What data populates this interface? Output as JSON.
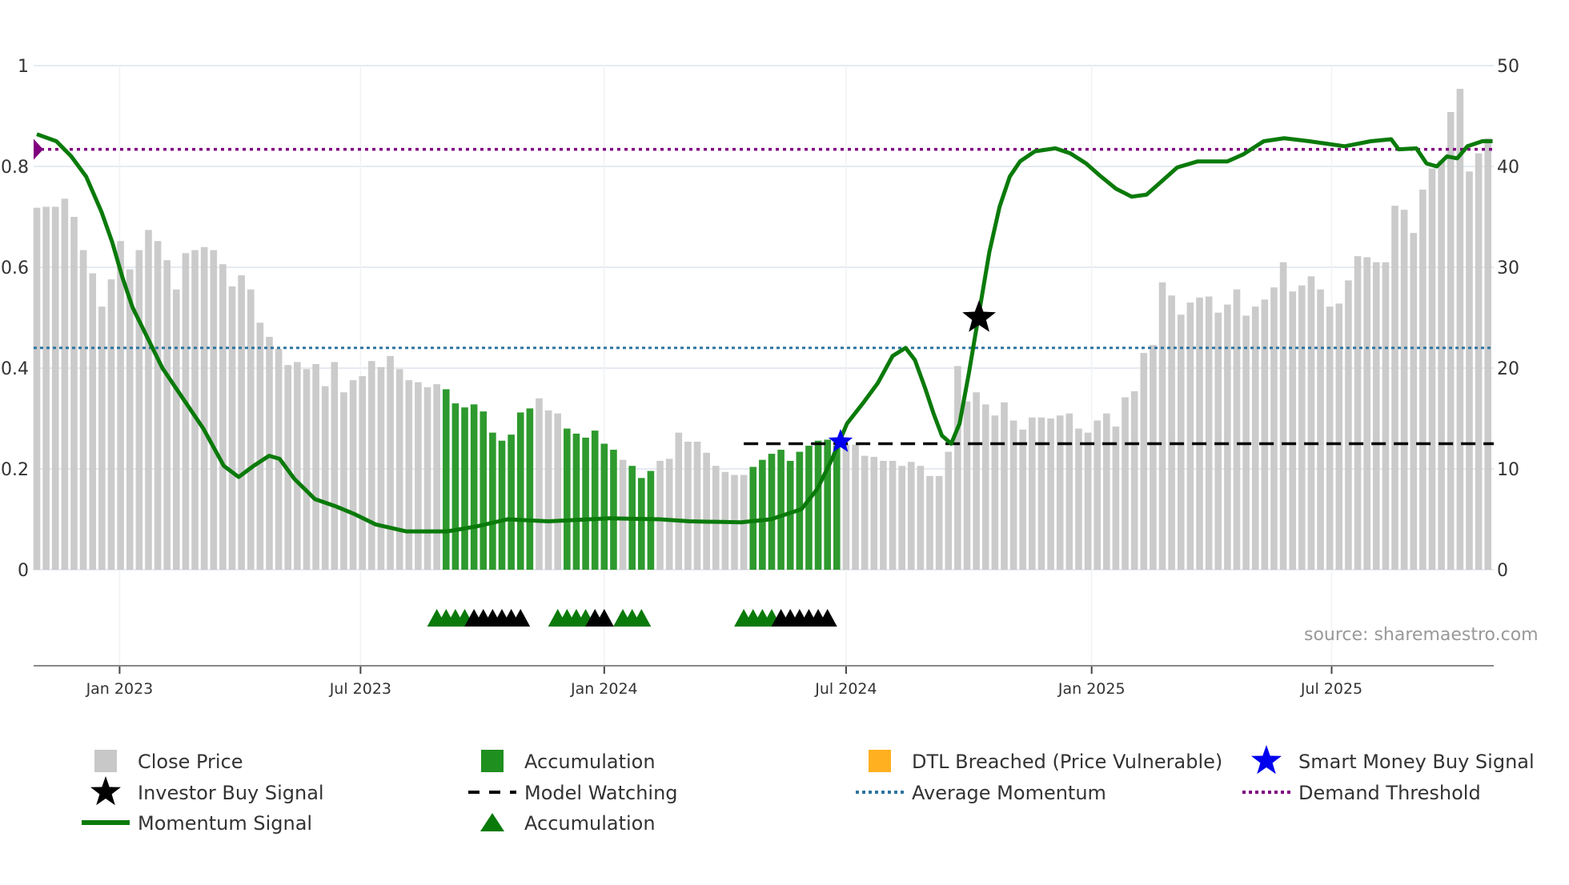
{
  "chart_data": {
    "type": "bar",
    "source": "source: sharemaestro.com",
    "left_axis": {
      "ylim": [
        0,
        1
      ],
      "ticks": [
        "0",
        "0.2",
        "0.4",
        "0.6",
        "0.8",
        "1"
      ],
      "tick_values": [
        0,
        0.2,
        0.4,
        0.6,
        0.8,
        1
      ]
    },
    "right_axis": {
      "ylim": [
        0,
        50
      ],
      "ticks": [
        "0",
        "10",
        "20",
        "30",
        "40",
        "50"
      ],
      "tick_values": [
        0,
        10,
        20,
        30,
        40,
        50
      ]
    },
    "x_ticks": [
      {
        "label": "Jan 2023",
        "week": 8.9
      },
      {
        "label": "Jul 2023",
        "week": 34.8
      },
      {
        "label": "Jan 2024",
        "week": 61.0
      },
      {
        "label": "Jul 2024",
        "week": 87.0
      },
      {
        "label": "Jan 2025",
        "week": 113.4
      },
      {
        "label": "Jul 2025",
        "week": 139.2
      }
    ],
    "grid": true,
    "close_price": [
      35.9,
      36.0,
      36.0,
      36.8,
      35.0,
      31.7,
      29.4,
      26.1,
      28.8,
      32.6,
      29.8,
      31.7,
      33.7,
      32.6,
      30.7,
      27.8,
      31.4,
      31.7,
      32.0,
      31.7,
      30.3,
      28.1,
      29.2,
      27.8,
      24.5,
      23.1,
      21.9,
      20.3,
      20.6,
      19.9,
      20.4,
      18.2,
      20.6,
      17.6,
      18.8,
      19.2,
      20.7,
      20.1,
      21.2,
      19.9,
      18.8,
      18.6,
      18.1,
      18.4,
      17.9,
      16.5,
      16.1,
      16.4,
      15.7,
      13.6,
      12.8,
      13.4,
      15.6,
      16.0,
      17.0,
      15.8,
      15.5,
      14.0,
      13.5,
      13.1,
      13.8,
      12.5,
      11.9,
      10.9,
      10.3,
      9.1,
      9.8,
      10.8,
      11.0,
      13.6,
      12.7,
      12.7,
      11.6,
      10.3,
      9.7,
      9.4,
      9.4,
      10.2,
      10.9,
      11.5,
      11.9,
      10.8,
      11.7,
      12.3,
      12.8,
      12.9,
      12.3,
      12.4,
      12.4,
      11.3,
      11.2,
      10.8,
      10.8,
      10.3,
      10.7,
      10.3,
      9.3,
      9.3,
      11.7,
      20.2,
      16.7,
      17.6,
      16.4,
      15.3,
      16.6,
      14.8,
      13.9,
      15.1,
      15.1,
      15.0,
      15.3,
      15.5,
      14.0,
      13.6,
      14.8,
      15.5,
      14.2,
      17.1,
      17.7,
      21.5,
      22.3,
      28.5,
      27.2,
      25.3,
      26.5,
      27.0,
      27.1,
      25.5,
      26.3,
      27.8,
      25.2,
      26.1,
      26.8,
      28.0,
      30.5,
      27.6,
      28.2,
      29.1,
      27.8,
      26.1,
      26.4,
      28.7,
      31.1,
      31.0,
      30.5,
      30.5,
      36.1,
      35.7,
      33.4,
      37.7,
      39.8,
      40.6,
      45.4,
      47.7,
      39.5,
      41.3,
      42.8
    ],
    "bar_state": "g=close price, a=accumulation, d=DTL breached",
    "bar_states": "ggggggggggggggggggggggggggggggggggggggggggggaaaaaaaaaagggaaaaaagaaaggggggggggaaaaaaaaaaggggggggggggggggggggggggggggggggggggggggggggggggggggggggggggggggggggggggggggggddggd",
    "momentum": [
      [
        0,
        0.864
      ],
      [
        2.1,
        0.85
      ],
      [
        3.7,
        0.82
      ],
      [
        5.3,
        0.78
      ],
      [
        6.95,
        0.71
      ],
      [
        8.1,
        0.65
      ],
      [
        9.2,
        0.58
      ],
      [
        10.3,
        0.52
      ],
      [
        11.9,
        0.46
      ],
      [
        13.5,
        0.4
      ],
      [
        15.7,
        0.34
      ],
      [
        17.9,
        0.28
      ],
      [
        20.1,
        0.206
      ],
      [
        21.7,
        0.184
      ],
      [
        23.3,
        0.206
      ],
      [
        24.97,
        0.226
      ],
      [
        26.1,
        0.22
      ],
      [
        27.7,
        0.18
      ],
      [
        29.9,
        0.14
      ],
      [
        32.1,
        0.126
      ],
      [
        34.2,
        0.11
      ],
      [
        36.4,
        0.09
      ],
      [
        39.7,
        0.076
      ],
      [
        44.1,
        0.076
      ],
      [
        47.3,
        0.086
      ],
      [
        50.6,
        0.1
      ],
      [
        55.0,
        0.096
      ],
      [
        61.5,
        0.102
      ],
      [
        67.0,
        0.1
      ],
      [
        70.2,
        0.096
      ],
      [
        75.7,
        0.094
      ],
      [
        78.9,
        0.1
      ],
      [
        82.2,
        0.12
      ],
      [
        83.9,
        0.16
      ],
      [
        85.5,
        0.22
      ],
      [
        87.1,
        0.29
      ],
      [
        88.8,
        0.33
      ],
      [
        90.4,
        0.37
      ],
      [
        92.0,
        0.424
      ],
      [
        93.4,
        0.44
      ],
      [
        94.4,
        0.416
      ],
      [
        95.5,
        0.36
      ],
      [
        96.4,
        0.31
      ],
      [
        97.3,
        0.266
      ],
      [
        98.3,
        0.25
      ],
      [
        99.2,
        0.29
      ],
      [
        100.2,
        0.39
      ],
      [
        101.3,
        0.51
      ],
      [
        102.4,
        0.63
      ],
      [
        103.5,
        0.72
      ],
      [
        104.6,
        0.78
      ],
      [
        105.7,
        0.81
      ],
      [
        107.3,
        0.83
      ],
      [
        109.5,
        0.836
      ],
      [
        111.1,
        0.826
      ],
      [
        112.8,
        0.806
      ],
      [
        114.4,
        0.78
      ],
      [
        116.0,
        0.756
      ],
      [
        117.7,
        0.74
      ],
      [
        119.3,
        0.744
      ],
      [
        120.9,
        0.77
      ],
      [
        122.6,
        0.798
      ],
      [
        124.8,
        0.81
      ],
      [
        128.0,
        0.81
      ],
      [
        129.7,
        0.824
      ],
      [
        131.9,
        0.85
      ],
      [
        134.1,
        0.856
      ],
      [
        136.8,
        0.85
      ],
      [
        140.6,
        0.84
      ],
      [
        143.4,
        0.85
      ],
      [
        145.6,
        0.854
      ],
      [
        146.4,
        0.834
      ],
      [
        148.3,
        0.836
      ],
      [
        149.4,
        0.806
      ],
      [
        150.5,
        0.8
      ],
      [
        151.6,
        0.82
      ],
      [
        152.7,
        0.816
      ],
      [
        153.8,
        0.84
      ],
      [
        155.4,
        0.85
      ],
      [
        156.5,
        0.85
      ]
    ],
    "demand_threshold": 0.834,
    "average_momentum": 0.44,
    "model_watching": {
      "value": 0.25,
      "from_week": 76
    },
    "smart_money_buy_signal": {
      "week": 86.4,
      "value": 0.254
    },
    "investor_buy_signal": {
      "week": 101.3,
      "value": 0.5
    },
    "accumulation_triangles": {
      "green": [
        43,
        44,
        45,
        46,
        56,
        57,
        58,
        59,
        63,
        64,
        65,
        76,
        77,
        78,
        79
      ],
      "black": [
        47,
        48,
        49,
        50,
        51,
        52,
        60,
        61,
        80,
        81,
        82,
        83,
        84,
        85
      ]
    },
    "colors": {
      "close": "#c8c8c8",
      "accumulation": "#2e9a2e",
      "dtl": "#ffcc80",
      "momentum": "#0a7a0a",
      "demand": "#800080",
      "avg": "#2e75a0",
      "smart": "#0000ee"
    },
    "legend": [
      {
        "label": "Close Price",
        "icon": "grey-bar"
      },
      {
        "label": "Accumulation",
        "icon": "green-bar"
      },
      {
        "label": "DTL Breached (Price Vulnerable)",
        "icon": "orange-bar"
      },
      {
        "label": "Smart Money Buy Signal",
        "icon": "blue-star"
      },
      {
        "label": "Investor Buy Signal",
        "icon": "black-star"
      },
      {
        "label": "Model Watching",
        "icon": "dashed-line"
      },
      {
        "label": "Average Momentum",
        "icon": "blue-dotted-line"
      },
      {
        "label": "Demand Threshold",
        "icon": "purple-dotted-line"
      },
      {
        "label": "Momentum Signal",
        "icon": "green-line"
      },
      {
        "label": "Accumulation",
        "icon": "green-triangle"
      }
    ]
  }
}
